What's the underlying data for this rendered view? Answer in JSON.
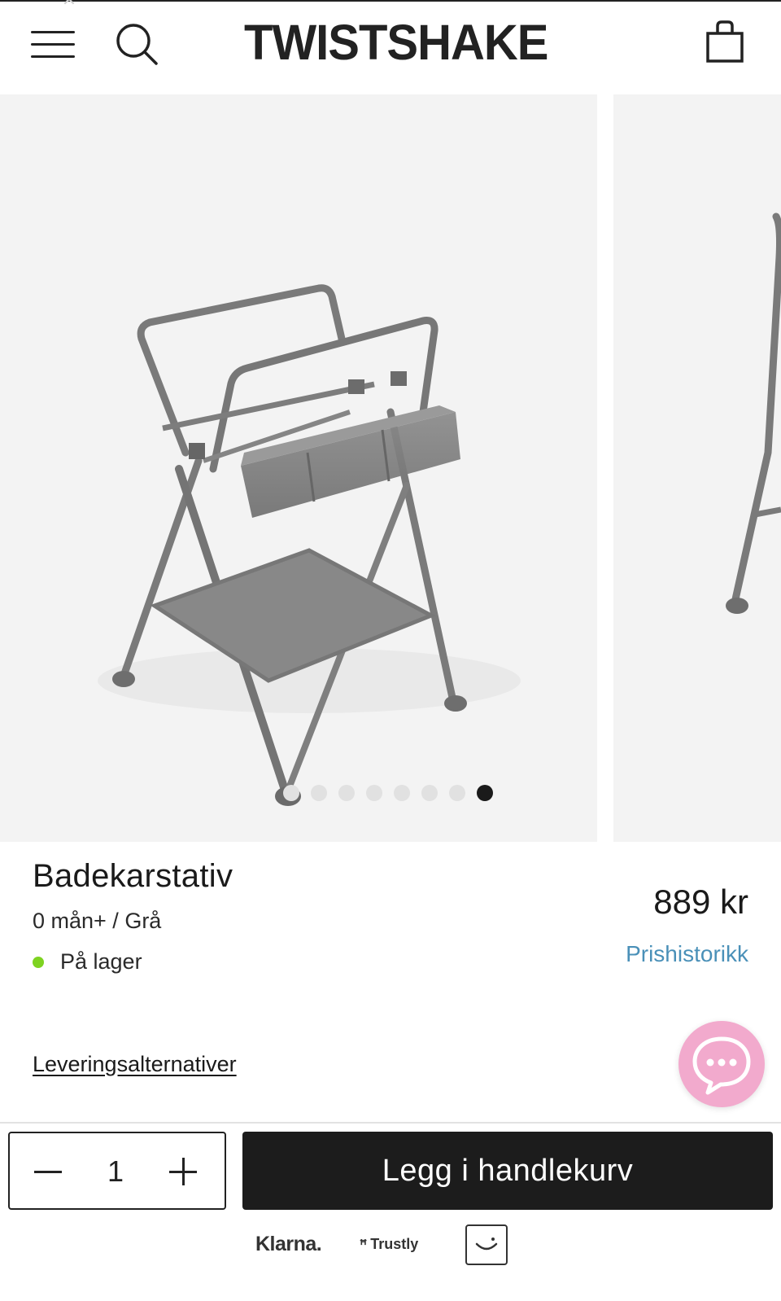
{
  "header": {
    "logo_text": "TWISTSHAKE",
    "menu_icon": "hamburger-menu-icon",
    "search_icon": "search-icon",
    "cart_icon": "shopping-bag-icon"
  },
  "gallery": {
    "slide_count": 8,
    "active_index": 7,
    "image_subject": "grey bath tub stand with storage basket and bottom shelf"
  },
  "product": {
    "title": "Badekarstativ",
    "variant": "0 mån+ / Grå",
    "stock_status": "På lager",
    "stock_color": "#7ed321",
    "price": "889 kr",
    "price_history_link": "Prishistorikk",
    "delivery_link": "Leveringsalternativer"
  },
  "chat": {
    "icon": "chat-bubble-icon",
    "color": "#f2aacd"
  },
  "cart_bar": {
    "quantity": "1",
    "minus_icon": "minus-icon",
    "plus_icon": "plus-icon",
    "add_to_cart_label": "Legg i handlekurv"
  },
  "payments": {
    "klarna": "Klarna.",
    "trustly": "Trustly",
    "third_icon": "smile-logo-icon"
  },
  "colors": {
    "accent_dark": "#1c1c1c",
    "link_blue": "#4a90b8"
  }
}
